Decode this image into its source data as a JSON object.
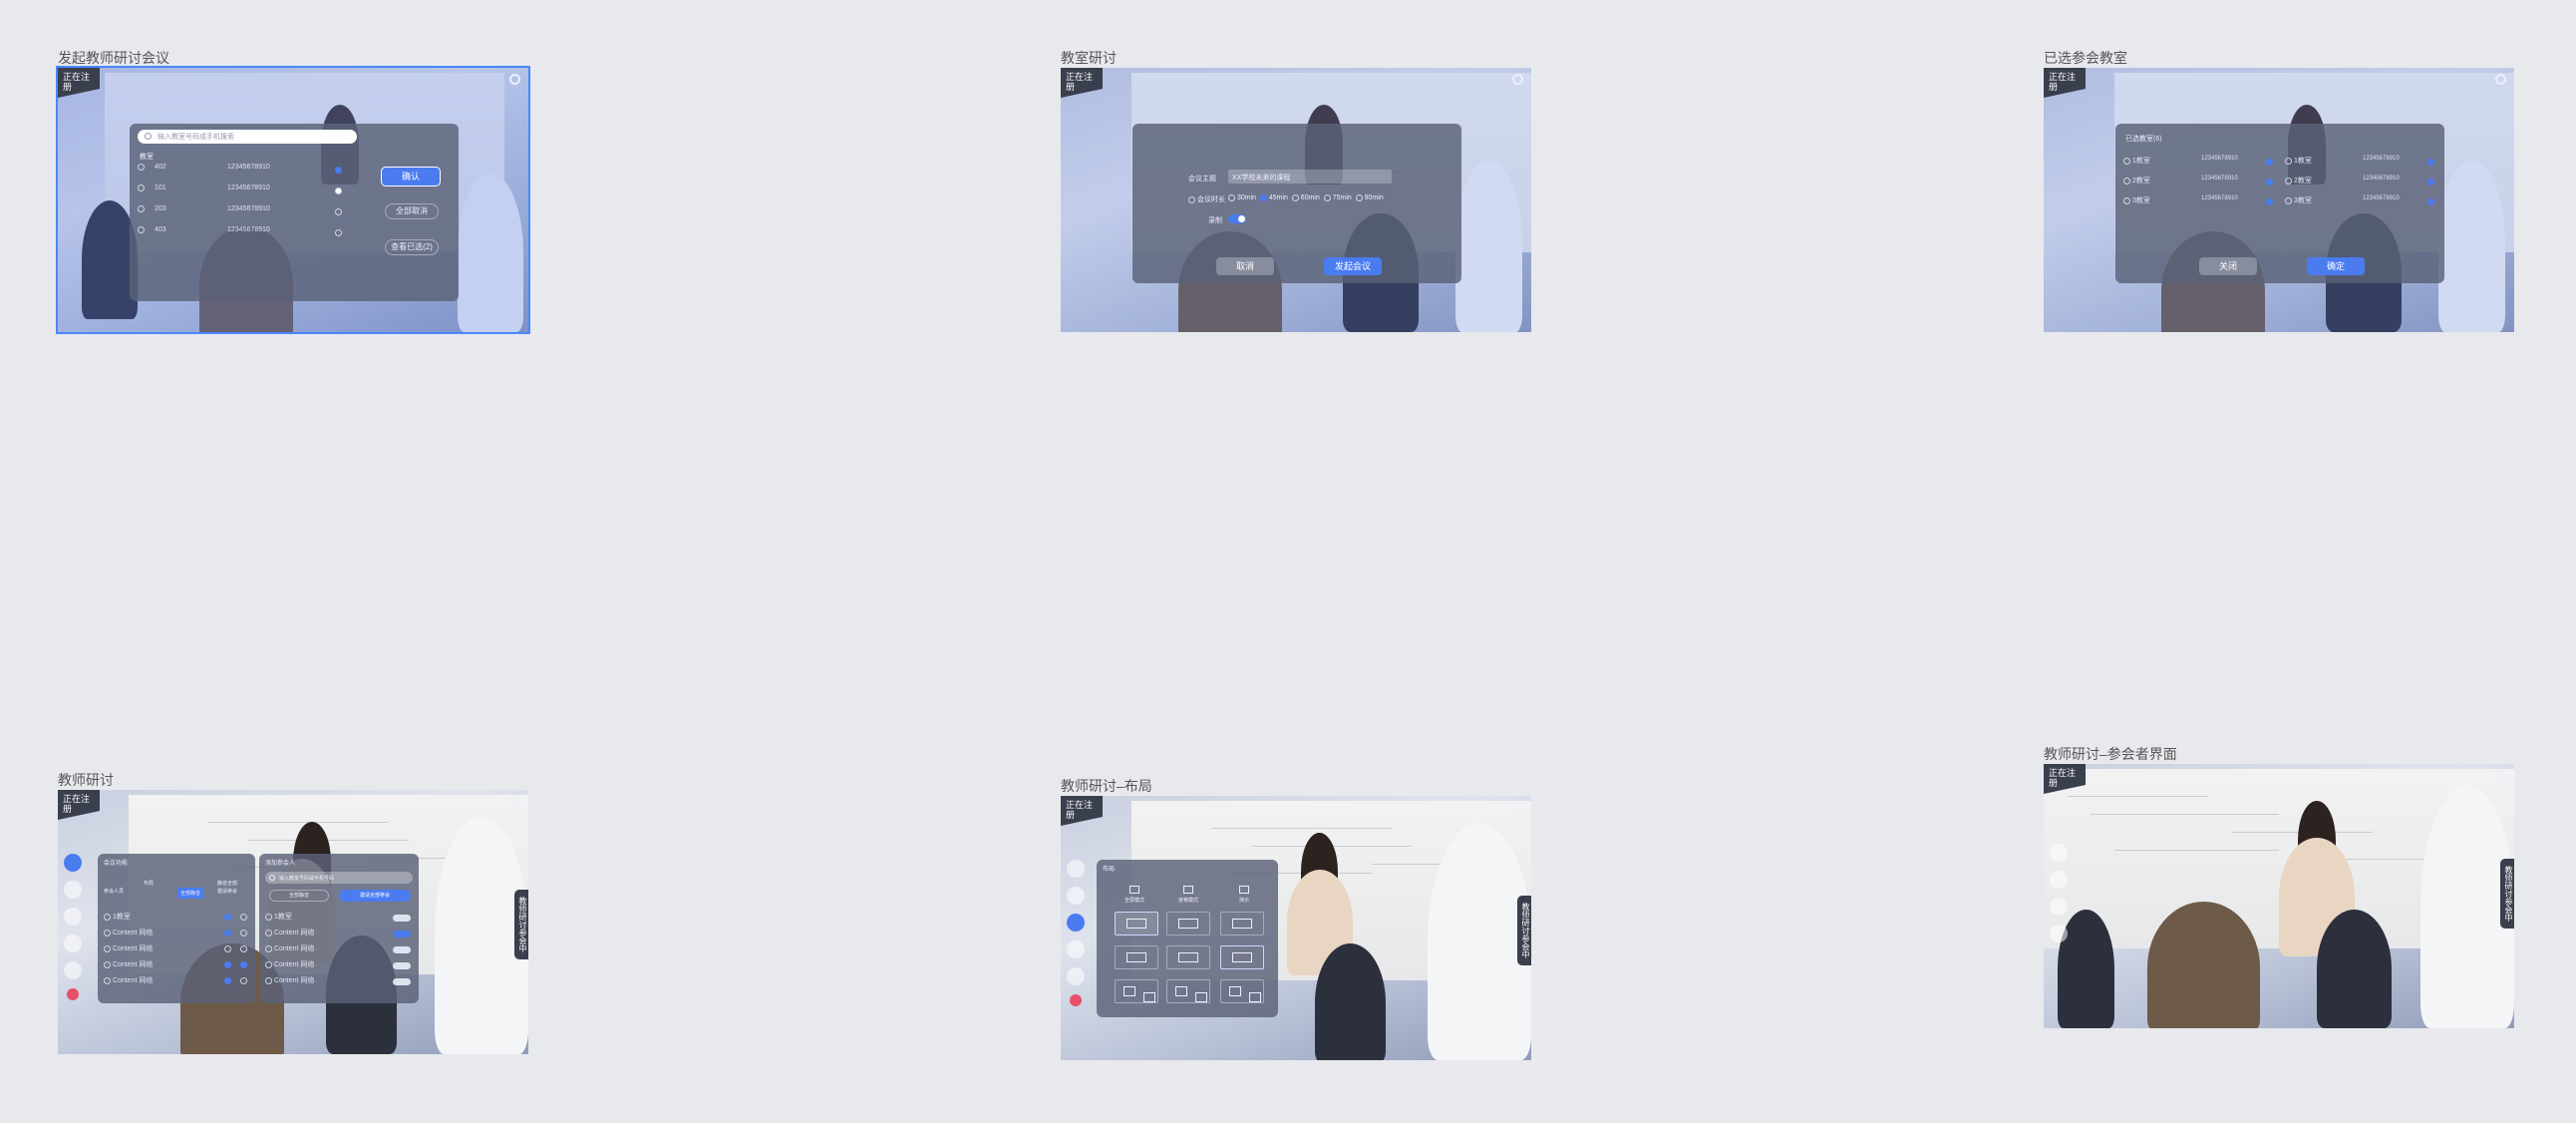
{
  "boards": {
    "b1": {
      "title": "发起教师研讨会议",
      "rec_badge": "正在注册",
      "search_placeholder": "输入教室号码或手机搜索",
      "group_label": "教室",
      "rows": [
        {
          "room": "402",
          "id": "12345678910"
        },
        {
          "room": "101",
          "id": "12345678910"
        },
        {
          "room": "203",
          "id": "12345678910"
        },
        {
          "room": "403",
          "id": "12345678910"
        }
      ],
      "btn_confirm": "确认",
      "btn_cancel_all": "全部取消",
      "btn_view_selected": "查看已选(2)"
    },
    "b2": {
      "title": "教室研讨",
      "rec_badge": "正在注册",
      "topic_label": "会议主题",
      "topic_value": "XX学校未来的课程",
      "duration_label": "会议时长",
      "durations": [
        "30min",
        "45min",
        "60min",
        "75min",
        "90min"
      ],
      "record_label": "录制",
      "btn_cancel": "取消",
      "btn_start": "发起会议"
    },
    "b3": {
      "title": "已选参会教室",
      "rec_badge": "正在注册",
      "header": "已选教室(6)",
      "rooms_left": [
        {
          "name": "1教室",
          "id": "12345678910"
        },
        {
          "name": "2教室",
          "id": "12345678910"
        },
        {
          "name": "3教室",
          "id": "12345678910"
        }
      ],
      "rooms_right": [
        {
          "name": "1教室",
          "id": "12345678910"
        },
        {
          "name": "2教室",
          "id": "12345678910"
        },
        {
          "name": "3教室",
          "id": "12345678910"
        }
      ],
      "btn_cancel": "关闭",
      "btn_ok": "确定"
    },
    "b4": {
      "title": "教师研讨",
      "rec_badge": "正在注册",
      "left_panel_title": "会议功能",
      "tabs": [
        "参会人员",
        "布局",
        "全部静音",
        "静音全部",
        "邀请参会"
      ],
      "participants": [
        "1教室",
        "Content 网络",
        "Content 网络",
        "Content 网络",
        "Content 网络"
      ],
      "right_panel_title": "添加参会人",
      "search_placeholder": "输入教室号码或手机号码",
      "btn_all_mute": "全部静音",
      "btn_invite": "邀请全部参会",
      "contacts": [
        "1教室",
        "Content 网络",
        "Content 网络",
        "Content 网络",
        "Content 网络"
      ]
    },
    "b5": {
      "title": "教师研讨–布局",
      "rec_badge": "正在注册",
      "panel_title": "布局",
      "modes": [
        "全屏模式",
        "宫格模式",
        "演示"
      ]
    },
    "b6": {
      "title": "教师研讨–参会者界面",
      "rec_badge": "正在注册",
      "side_tab": "教师研讨参会中"
    }
  },
  "colors": {
    "accent": "#4a7cf0",
    "background": "#e8e9ed",
    "panel": "#5a6278"
  }
}
